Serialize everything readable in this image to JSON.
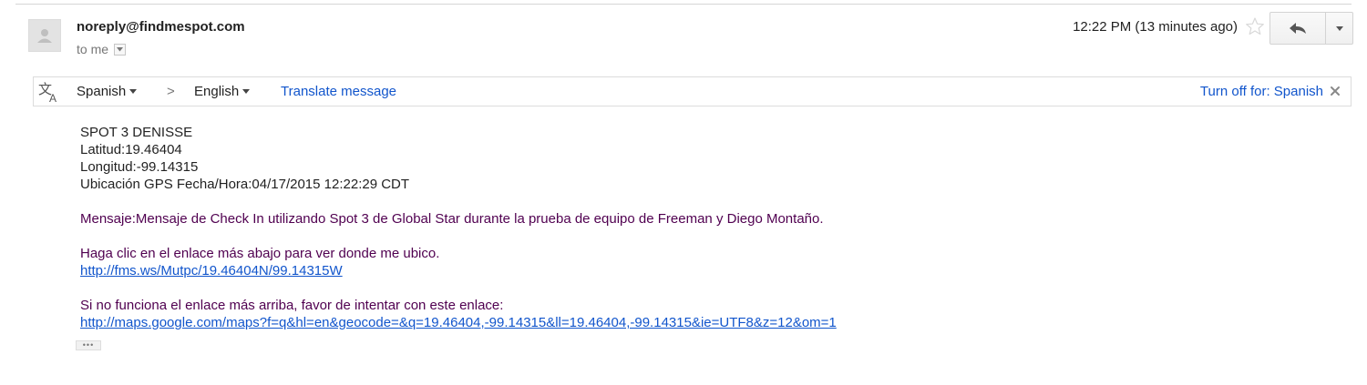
{
  "header": {
    "sender": "noreply@findmespot.com",
    "recipient": "to me",
    "timestamp": "12:22 PM (13 minutes ago)"
  },
  "icons": {
    "avatar": "avatar-placeholder-icon",
    "star": "star-icon",
    "reply": "reply-icon",
    "more": "chevron-down-icon",
    "translate": "translate-icon",
    "close": "close-icon",
    "details": "chevron-down-icon"
  },
  "translate_bar": {
    "from_language": "Spanish",
    "arrow": ">",
    "to_language": "English",
    "translate_link": "Translate message",
    "turn_off_link": "Turn off for: Spanish"
  },
  "message": {
    "lines": [
      "SPOT 3 DENISSE",
      "Latitud:19.46404",
      "Longitud:-99.14315",
      "Ubicación GPS Fecha/Hora:04/17/2015 12:22:29 CDT"
    ],
    "mensaje": "Mensaje:Mensaje de Check In utilizando Spot 3 de Global Star durante la prueba de equipo de Freeman y Diego Montaño.",
    "click_text": "Haga clic en el enlace más abajo para ver donde me ubico.",
    "link1": "http://fms.ws/Mutpc/19.46404N/99.14315W",
    "fallback_text": "Si no funciona el enlace más arriba, favor de intentar con este enlace:",
    "link2": "http://maps.google.com/maps?f=q&hl=en&geocode=&q=19.46404,-99.14315&ll=19.46404,-99.14315&ie=UTF8&z=12&om=1",
    "show_trimmed": "•••"
  },
  "colors": {
    "link": "#1155cc",
    "quoted_text": "#500050",
    "primary_text": "#222222",
    "secondary_text": "#777777"
  }
}
